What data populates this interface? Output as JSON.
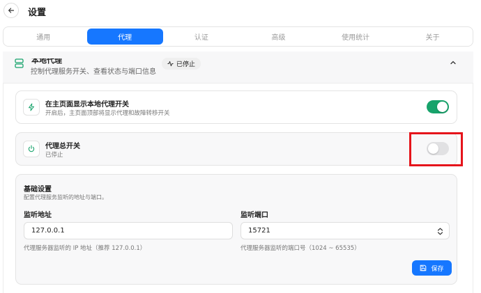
{
  "header": {
    "title": "设置"
  },
  "tabs": [
    {
      "label": "通用"
    },
    {
      "label": "代理"
    },
    {
      "label": "认证"
    },
    {
      "label": "高级"
    },
    {
      "label": "使用统计"
    },
    {
      "label": "关于"
    }
  ],
  "active_tab": "代理",
  "section": {
    "title": "本地代理",
    "subtitle": "控制代理服务开关、查看状态与端口信息",
    "status": "已停止"
  },
  "cards": {
    "show_on_home": {
      "title": "在主页面显示本地代理开关",
      "subtitle": "开启后，主页面顶部将显示代理和故障转移开关",
      "toggle_on": true
    },
    "master_switch": {
      "title": "代理总开关",
      "subtitle": "已停止",
      "toggle_on": false
    }
  },
  "basic": {
    "title": "基础设置",
    "subtitle": "配置代理服务监听的地址与端口。",
    "address": {
      "label": "监听地址",
      "value": "127.0.0.1",
      "hint": "代理服务器监听的 IP 地址（推荐 127.0.0.1）"
    },
    "port": {
      "label": "监听端口",
      "value": "15721",
      "hint": "代理服务器监听的端口号（1024 ~ 65535）"
    },
    "save_label": "保存"
  },
  "colors": {
    "accent": "#1677ff",
    "toggle_on": "#17a36b",
    "highlight": "#e5141b"
  },
  "icons": {
    "back": "arrow-left-icon",
    "section": "server-icon",
    "status": "activity-icon",
    "collapse": "chevron-up-icon",
    "show_on_home": "zap-icon",
    "master_switch": "power-icon",
    "port_stepper": "chevrons-up-down-icon",
    "save": "save-icon"
  }
}
